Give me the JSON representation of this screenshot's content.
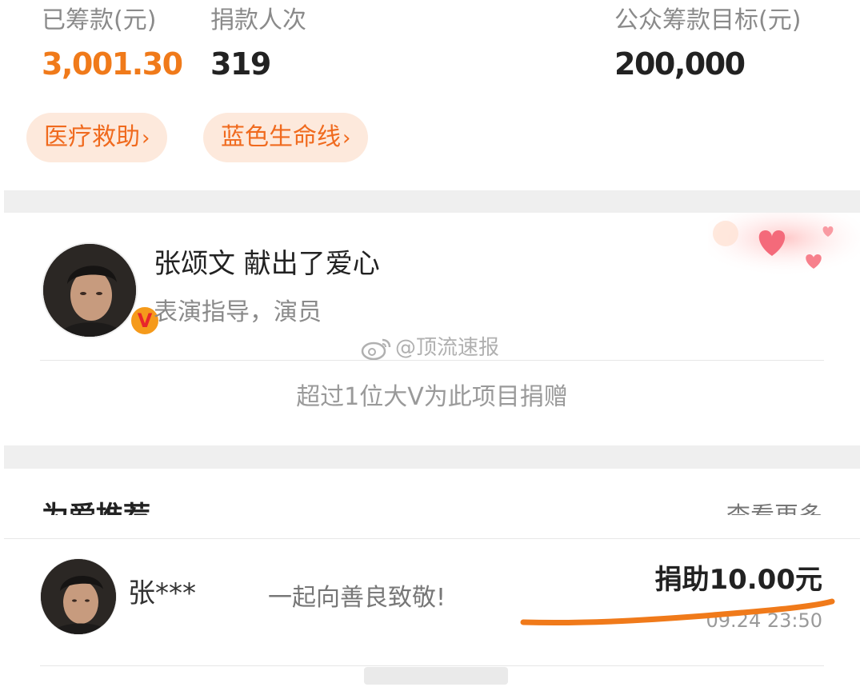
{
  "stats": {
    "raised_label": "已筹款(元)",
    "raised_value": "3,001.30",
    "count_label": "捐款人次",
    "count_value": "319",
    "target_label": "公众筹款目标(元)",
    "target_value": "200,000"
  },
  "tags": [
    {
      "label": "医疗救助",
      "chevron": "›"
    },
    {
      "label": "蓝色生命线",
      "chevron": "›"
    }
  ],
  "celebrity": {
    "name_line": "张颂文 献出了爱心",
    "description": "表演指导，演员",
    "badge": "V",
    "more_text": "超过1位大V为此项目捐赠"
  },
  "watermark": {
    "text": "@顶流速报"
  },
  "recommend": {
    "title": "为爱推荐",
    "more": "查看更多"
  },
  "record": {
    "name": "张***",
    "message": "一起向善良致敬!",
    "amount": "捐助10.00元",
    "time": "09.24 23:50"
  },
  "colors": {
    "accent_orange": "#f07a1a",
    "tag_bg": "#fde9dc",
    "tag_text": "#f06a1e",
    "underline_mark": "#f07a1a",
    "separator": "#efefef"
  },
  "icons": {
    "verified_badge": "verified-v-badge-icon",
    "hearts": "hearts-decoration-icon",
    "weibo_logo": "weibo-logo-icon"
  }
}
